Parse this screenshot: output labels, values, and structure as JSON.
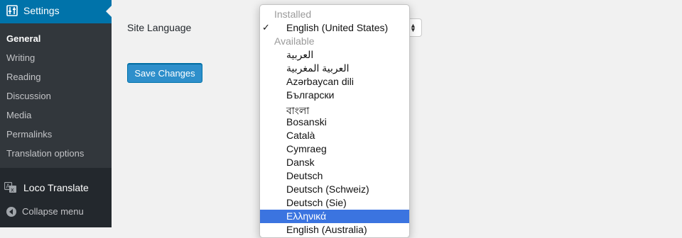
{
  "sidebar": {
    "settings_label": "Settings",
    "items": [
      {
        "label": "General",
        "current": true
      },
      {
        "label": "Writing"
      },
      {
        "label": "Reading"
      },
      {
        "label": "Discussion"
      },
      {
        "label": "Media"
      },
      {
        "label": "Permalinks"
      },
      {
        "label": "Translation options"
      }
    ],
    "loco_label": "Loco Translate",
    "collapse_label": "Collapse menu"
  },
  "form": {
    "site_language_label": "Site Language",
    "save_button": "Save Changes"
  },
  "dropdown": {
    "group_installed": "Installed",
    "group_available": "Available",
    "selected_check": "✓",
    "options": [
      "English (United States)",
      "العربية",
      "العربية المغربية",
      "Azərbaycan dili",
      "Български",
      "বাংলা",
      "Bosanski",
      "Català",
      "Cymraeg",
      "Dansk",
      "Deutsch",
      "Deutsch (Schweiz)",
      "Deutsch (Sie)",
      "Ελληνικά",
      "English (Australia)"
    ],
    "highlighted": "Ελληνικά"
  },
  "colors": {
    "sidebar_bg": "#23282d",
    "submenu_bg": "#32373c",
    "active_menu_bg": "#0073aa",
    "button_bg": "#2e8fcb",
    "highlight_bg": "#3b74e0"
  },
  "icons": {
    "settings": "settings-sliders-icon",
    "loco": "translate-icon",
    "collapse": "collapse-arrow-icon"
  }
}
